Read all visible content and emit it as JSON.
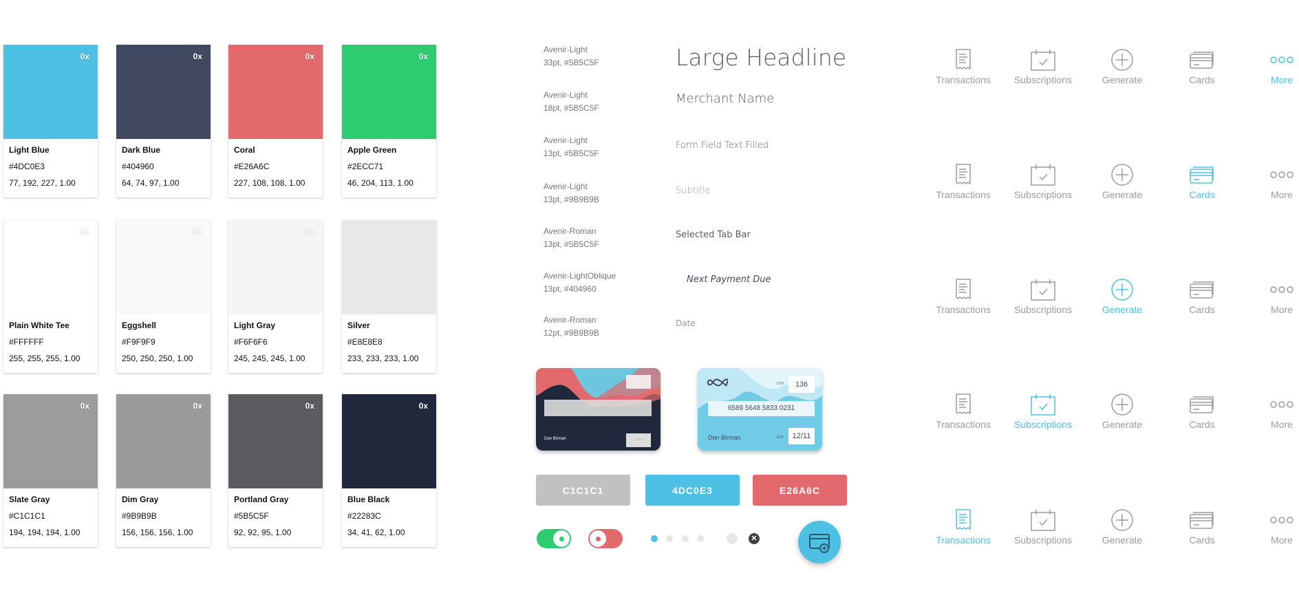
{
  "swatches": [
    {
      "name": "Light Blue",
      "hex": "#4DC0E3",
      "rgb": "77, 192, 227, 1.00",
      "badge": "0x",
      "display": "#4DC0E3"
    },
    {
      "name": "Dark Blue",
      "hex": "#404960",
      "rgb": "64, 74, 97, 1.00",
      "badge": "0x",
      "display": "#404960"
    },
    {
      "name": "Coral",
      "hex": "#E26A6C",
      "rgb": "227, 108, 108, 1.00",
      "badge": "0x",
      "display": "#E26A6C"
    },
    {
      "name": "Apple Green",
      "hex": "#2ECC71",
      "rgb": "46, 204, 113, 1.00",
      "badge": "0x",
      "display": "#2ECC71"
    },
    {
      "name": "Plain White Tee",
      "hex": "#FFFFFF",
      "rgb": "255, 255, 255, 1.00",
      "badge": "0x",
      "display": "#FFFFFF"
    },
    {
      "name": "Eggshell",
      "hex": "#F9F9F9",
      "rgb": "250, 250, 250, 1.00",
      "badge": "0x",
      "display": "#F9F9F9"
    },
    {
      "name": "Light Gray",
      "hex": "#F6F6F6",
      "rgb": "245, 245, 245, 1.00",
      "badge": "0x",
      "display": "#F5F5F5"
    },
    {
      "name": "Silver",
      "hex": "#E8E8E8",
      "rgb": "233, 233, 233, 1.00",
      "badge": "0x",
      "display": "#E8E8E8"
    },
    {
      "name": "Slate Gray",
      "hex": "#C1C1C1",
      "rgb": "194, 194, 194, 1.00",
      "badge": "0x",
      "display": "#9C9C9C"
    },
    {
      "name": "Dim Gray",
      "hex": "#9B9B9B",
      "rgb": "156, 156, 156, 1.00",
      "badge": "0x",
      "display": "#9B9B9B"
    },
    {
      "name": "Portland Gray",
      "hex": "#5B5C5F",
      "rgb": "92, 92, 95, 1.00",
      "badge": "0x",
      "display": "#5B5C5F"
    },
    {
      "name": "Blue Black",
      "hex": "#22283C",
      "rgb": "34, 41, 62, 1.00",
      "badge": "0x",
      "display": "#22283C"
    }
  ],
  "typography": [
    {
      "font": "Avenir-Light",
      "spec": "33pt, #5B5C5F",
      "sample": "Large Headline",
      "color": "#5B5C5F"
    },
    {
      "font": "Avenir-Light",
      "spec": "18pt, #5B5C5F",
      "sample": "Merchant Name",
      "color": "#5B5C5F"
    },
    {
      "font": "Avenir-Light",
      "spec": "13pt, #5B5C5F",
      "sample": "Form Field Text Filled",
      "color": "#5B5C5F"
    },
    {
      "font": "Avenir-Light",
      "spec": "13pt, #9B9B9B",
      "sample": "Subtitle",
      "color": "#9B9B9B"
    },
    {
      "font": "Avenir-Roman",
      "spec": "13pt, #5B5C5F",
      "sample": "Selected Tab Bar",
      "color": "#5B5C5F"
    },
    {
      "font": "Avenir-LightOblique",
      "spec": "13pt, #404960",
      "sample": "Next Payment Due",
      "color": "#404960"
    },
    {
      "font": "Avenir-Roman",
      "spec": "12pt, #9B9B9B",
      "sample": "Date",
      "color": "#9B9B9B"
    }
  ],
  "cards": {
    "dark": {
      "name": "Dan Birman",
      "exp": "--/--"
    },
    "light": {
      "cvv_label": "CVV",
      "cvv": "136",
      "number": "6589 5648 5833 0231",
      "name": "Dan Birman",
      "exp_label": "EXP",
      "exp": "12/11"
    }
  },
  "buttons": [
    {
      "label": "C1C1C1",
      "color": "#C1C1C1"
    },
    {
      "label": "4DC0E3",
      "color": "#4DC0E3"
    },
    {
      "label": "E26A6C",
      "color": "#E26A6C"
    }
  ],
  "controls": {
    "toggle_on": true,
    "toggle_off": false,
    "page_dots": 4,
    "active_page": 1,
    "accent": "#4DC0E3"
  },
  "tabbar": {
    "tabs": [
      {
        "label": "Transactions",
        "icon": "receipt-icon"
      },
      {
        "label": "Subscriptions",
        "icon": "calendar-check-icon"
      },
      {
        "label": "Generate",
        "icon": "plus-circle-icon"
      },
      {
        "label": "Cards",
        "icon": "cards-icon"
      },
      {
        "label": "More",
        "icon": "more-dots-icon"
      }
    ],
    "selected_per_row": [
      4,
      3,
      2,
      1,
      0
    ]
  }
}
